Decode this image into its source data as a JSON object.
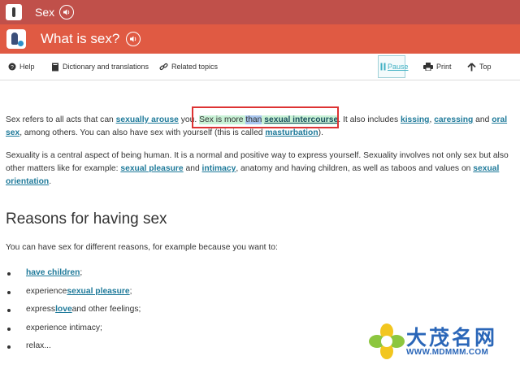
{
  "topbar": {
    "title": "Sex"
  },
  "titlebar": {
    "title": "What is sex?"
  },
  "toolbar": {
    "help": "Help",
    "dictionary": "Dictionary and translations",
    "related": "Related topics",
    "pause": "Pause",
    "print": "Print",
    "top": "Top"
  },
  "paragraph1": {
    "t1": "Sex refers to all acts that can ",
    "link_sexually_arouse": "sexually arouse",
    "t2": " you. ",
    "hl1": "Sex is more ",
    "hl_word": "than",
    "hl2": " ",
    "link_intercourse": "sexual intercourse",
    "t3": ". It also includes ",
    "link_kissing": "kissing",
    "t4": ", ",
    "link_caressing": "caressing",
    "t5": " and ",
    "link_oral_sex": "oral sex",
    "t6": ", among others. You can also have sex with yourself (this is called ",
    "link_masturbation": "masturbation",
    "t7": ")."
  },
  "paragraph2": {
    "t1": "Sexuality is a central aspect of being human. It is a normal and positive way to express yourself. Sexuality involves not only sex but also other matters like for example: ",
    "link_pleasure": "sexual pleasure",
    "t2": " and ",
    "link_intimacy": "intimacy",
    "t3": ", anatomy and having children, as well as taboos and values on ",
    "link_orientation": "sexual orientation",
    "t4": "."
  },
  "section": {
    "heading": "Reasons for having sex",
    "intro": "You can have sex for different reasons, for example because you want to:",
    "items": [
      {
        "pre": "",
        "link": "have children",
        "post": ";"
      },
      {
        "pre": "experience ",
        "link": "sexual pleasure",
        "post": ";"
      },
      {
        "pre": "express ",
        "link": "love",
        "post": " and other feelings;"
      },
      {
        "pre": "experience intimacy;",
        "link": "",
        "post": ""
      },
      {
        "pre": "relax...",
        "link": "",
        "post": ""
      }
    ]
  },
  "watermark": {
    "chinese": "大茂名网",
    "url": "WWW.MDMMM.COM"
  },
  "colors": {
    "topbar": "#c0504a",
    "titlebar": "#e05a43",
    "link": "#1f7a9a",
    "highlight": "#c9f2d6",
    "pause": "#3fb0c3"
  }
}
